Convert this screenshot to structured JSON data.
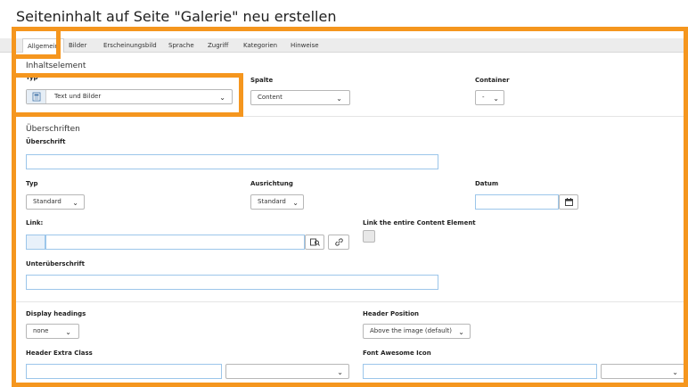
{
  "page": {
    "title": "Seiteninhalt auf Seite \"Galerie\" neu erstellen"
  },
  "tabs": [
    {
      "label": "Allgemein",
      "active": true
    },
    {
      "label": "Bilder"
    },
    {
      "label": "Erscheinungsbild"
    },
    {
      "label": "Sprache"
    },
    {
      "label": "Zugriff"
    },
    {
      "label": "Kategorien"
    },
    {
      "label": "Hinweise"
    }
  ],
  "content_element": {
    "section_title": "Inhaltselement",
    "type_label": "Typ",
    "type_value": "Text und Bilder",
    "column_label": "Spalte",
    "column_value": "Content",
    "container_label": "Container",
    "container_value": "-"
  },
  "headings": {
    "section_title": "Überschriften",
    "header_label": "Überschrift",
    "header_value": "",
    "type_label": "Typ",
    "type_value": "Standard",
    "alignment_label": "Ausrichtung",
    "alignment_value": "Standard",
    "date_label": "Datum",
    "date_value": "",
    "link_label": "Link:",
    "link_value": "",
    "link_entire_label": "Link the entire Content Element",
    "link_entire_checked": false,
    "subheader_label": "Unterüberschrift",
    "subheader_value": ""
  },
  "display": {
    "display_headings_label": "Display headings",
    "display_headings_value": "none",
    "header_position_label": "Header Position",
    "header_position_value": "Above the image (default)",
    "header_extra_class_label": "Header Extra Class",
    "header_extra_class_value": "",
    "font_awesome_label": "Font Awesome Icon",
    "font_awesome_value": ""
  },
  "icons": {
    "chevron": "chevron-down-icon",
    "calendar": "calendar-icon",
    "browse": "browse-icon",
    "link": "link-icon",
    "content_type": "text-image-icon"
  },
  "colors": {
    "highlight": "#f5961e",
    "input_border": "#9cc6ea"
  }
}
